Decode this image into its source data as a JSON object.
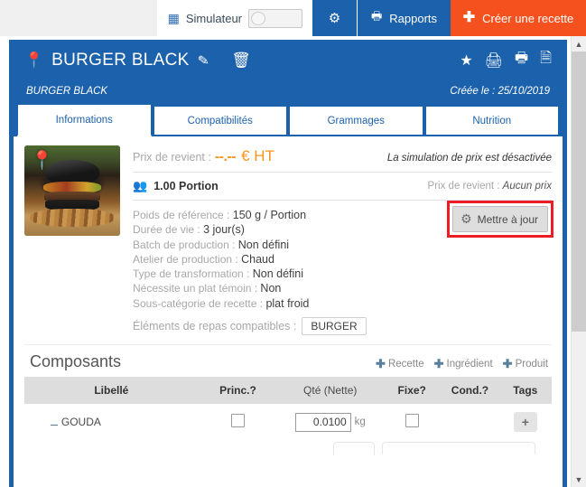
{
  "toolbar": {
    "simulateur_label": "Simulateur",
    "calc_icon": "calculator-icon",
    "toggle_state": "off",
    "gear_icon": "gear-icon",
    "rapports_label": "Rapports",
    "rapports_icon": "printer-icon",
    "create_label": "Créer une recette",
    "create_plus": "+",
    "create_color": "#f4511e",
    "accent_color": "#1c61ab"
  },
  "recipe": {
    "pin_icon": "location-pin-icon",
    "title": "BURGER BLACK",
    "edit_icon": "pencil-icon",
    "delete_icon": "trash-icon",
    "actions": [
      {
        "name": "favorite-star-icon",
        "glyph": "★"
      },
      {
        "name": "print-icon",
        "glyph": "🖨"
      },
      {
        "name": "print-preview-icon",
        "glyph": "🖶"
      },
      {
        "name": "duplicate-document-icon",
        "glyph": "🗎"
      }
    ],
    "subtitle": "BURGER BLACK",
    "created_label": "Créée le : 25/10/2019"
  },
  "tabs": [
    {
      "label": "Informations",
      "active": true
    },
    {
      "label": "Compatibilités",
      "active": false
    },
    {
      "label": "Grammages",
      "active": false
    },
    {
      "label": "Nutrition",
      "active": false
    }
  ],
  "info": {
    "thumbnail_name": "recipe-photo-burger",
    "thumbnail_pin": "location-pin-icon",
    "price": {
      "label": "Prix de revient :",
      "value": "--.--",
      "unit": "€ HT",
      "note": "La simulation de prix est désactivée",
      "color": "#f7941d"
    },
    "portion": {
      "icon": "people-icon",
      "value": "1.00 Portion",
      "right_label": "Prix de revient :",
      "right_value": "Aucun prix"
    },
    "facts": [
      {
        "key": "Poids de référence :",
        "value": "150 g / Portion"
      },
      {
        "key": "Durée de vie :",
        "value": "3 jour(s)"
      },
      {
        "key": "Batch de production :",
        "value": "Non défini"
      },
      {
        "key": "Atelier de production :",
        "value": "Chaud"
      },
      {
        "key": "Type de transformation :",
        "value": "Non défini"
      },
      {
        "key": "Nécessite un plat témoin :",
        "value": "Non"
      },
      {
        "key": "Sous-catégorie de recette :",
        "value": "plat froid"
      }
    ],
    "meal_elements": {
      "label": "Éléments de repas compatibles :",
      "chip": "BURGER"
    },
    "update_button": {
      "label": "Mettre à jour",
      "icon": "gear-icon",
      "highlight_color": "#ee1c24"
    }
  },
  "composants": {
    "title": "Composants",
    "links": [
      {
        "label": "Recette",
        "icon": "plus-icon"
      },
      {
        "label": "Ingrédient",
        "icon": "plus-icon"
      },
      {
        "label": "Produit",
        "icon": "plus-icon"
      }
    ],
    "columns": [
      "Libellé",
      "Princ.?",
      "Qté (Nette)",
      "Fixe?",
      "Cond.?",
      "Tags"
    ],
    "rows": [
      {
        "label": "GOUDA",
        "princ_checked": false,
        "qte": "0.0100",
        "unit": "kg",
        "fixe_checked": false,
        "cond": "",
        "tag_button": "+"
      }
    ]
  },
  "scrollbar": {
    "up_arrow": "chevron-up-icon",
    "down_arrow": "chevron-down-icon"
  }
}
